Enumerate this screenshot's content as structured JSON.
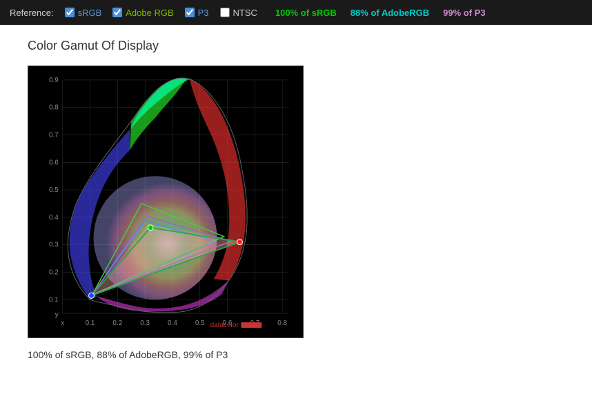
{
  "referenceBar": {
    "label": "Reference:",
    "items": [
      {
        "id": "srgb",
        "label": "sRGB",
        "checked": true,
        "colorClass": "ref-srgb"
      },
      {
        "id": "adobe",
        "label": "Adobe RGB",
        "checked": true,
        "colorClass": "ref-adobe"
      },
      {
        "id": "p3",
        "label": "P3",
        "checked": true,
        "colorClass": "ref-p3"
      },
      {
        "id": "ntsc",
        "label": "NTSC",
        "checked": false,
        "colorClass": "ref-ntsc"
      }
    ],
    "results": [
      {
        "id": "res-srgb",
        "label": "100% of sRGB",
        "colorClass": "result-srgb"
      },
      {
        "id": "res-adobe",
        "label": "88% of AdobeRGB",
        "colorClass": "result-adobe"
      },
      {
        "id": "res-p3",
        "label": "99% of P3",
        "colorClass": "result-p3"
      }
    ]
  },
  "chart": {
    "title": "Color Gamut Of Display",
    "summary": "100% of sRGB, 88% of AdobeRGB, 99% of P3"
  }
}
